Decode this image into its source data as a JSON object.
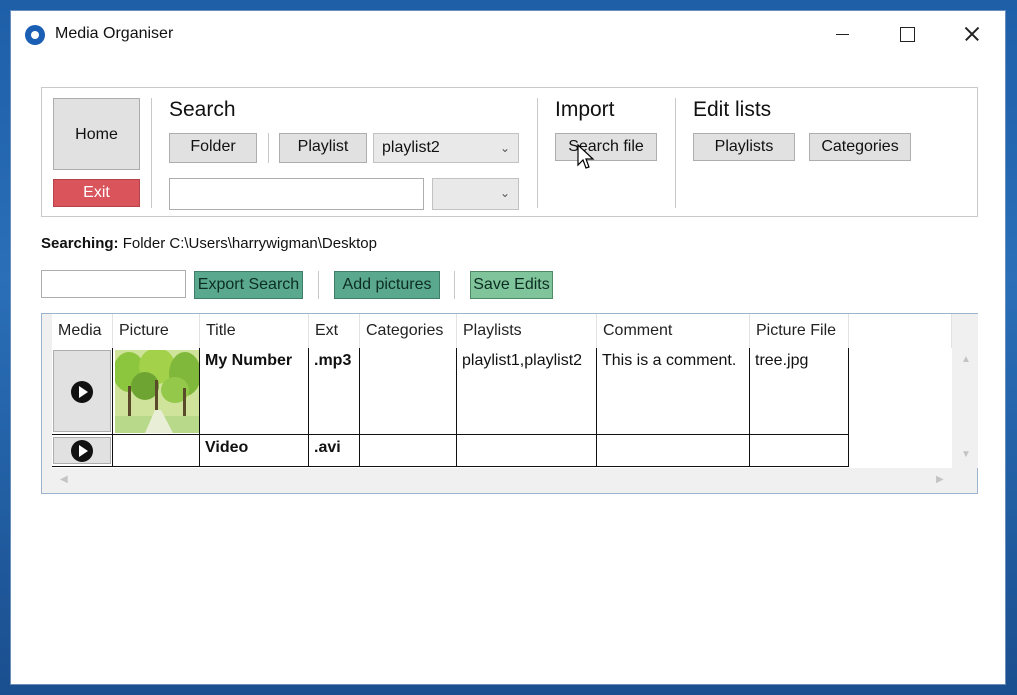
{
  "window": {
    "title": "Media Organiser",
    "icon": "disc-icon"
  },
  "toolbar": {
    "home_label": "Home",
    "exit_label": "Exit",
    "search": {
      "title": "Search",
      "folder_label": "Folder",
      "playlist_label": "Playlist",
      "playlist_selected": "playlist2",
      "text_value": "",
      "filter_selected": ""
    },
    "import": {
      "title": "Import",
      "search_file_label": "Search file"
    },
    "edit_lists": {
      "title": "Edit lists",
      "playlists_label": "Playlists",
      "categories_label": "Categories"
    }
  },
  "status": {
    "label": "Searching:",
    "text": "Folder  C:\\Users\\harrywigman\\Desktop"
  },
  "actions": {
    "filter_value": "",
    "export_label": "Export Search",
    "add_pictures_label": "Add pictures",
    "save_edits_label": "Save Edits"
  },
  "colors": {
    "exit": "#d9545b",
    "export": "#5aa98f",
    "add_pictures": "#5aa98f",
    "save_edits": "#7fc49a"
  },
  "table": {
    "columns": [
      "Media",
      "Picture",
      "Title",
      "Ext",
      "Categories",
      "Playlists",
      "Comment",
      "Picture File"
    ],
    "rows": [
      {
        "title": "My Number",
        "ext": ".mp3",
        "categories": "",
        "playlists": "playlist1,playlist2",
        "comment": "This is a comment.",
        "picture_file": "tree.jpg",
        "picture": "tree-thumbnail"
      },
      {
        "title": "Video",
        "ext": ".avi",
        "categories": "",
        "playlists": "",
        "comment": "",
        "picture_file": "",
        "picture": ""
      }
    ]
  }
}
